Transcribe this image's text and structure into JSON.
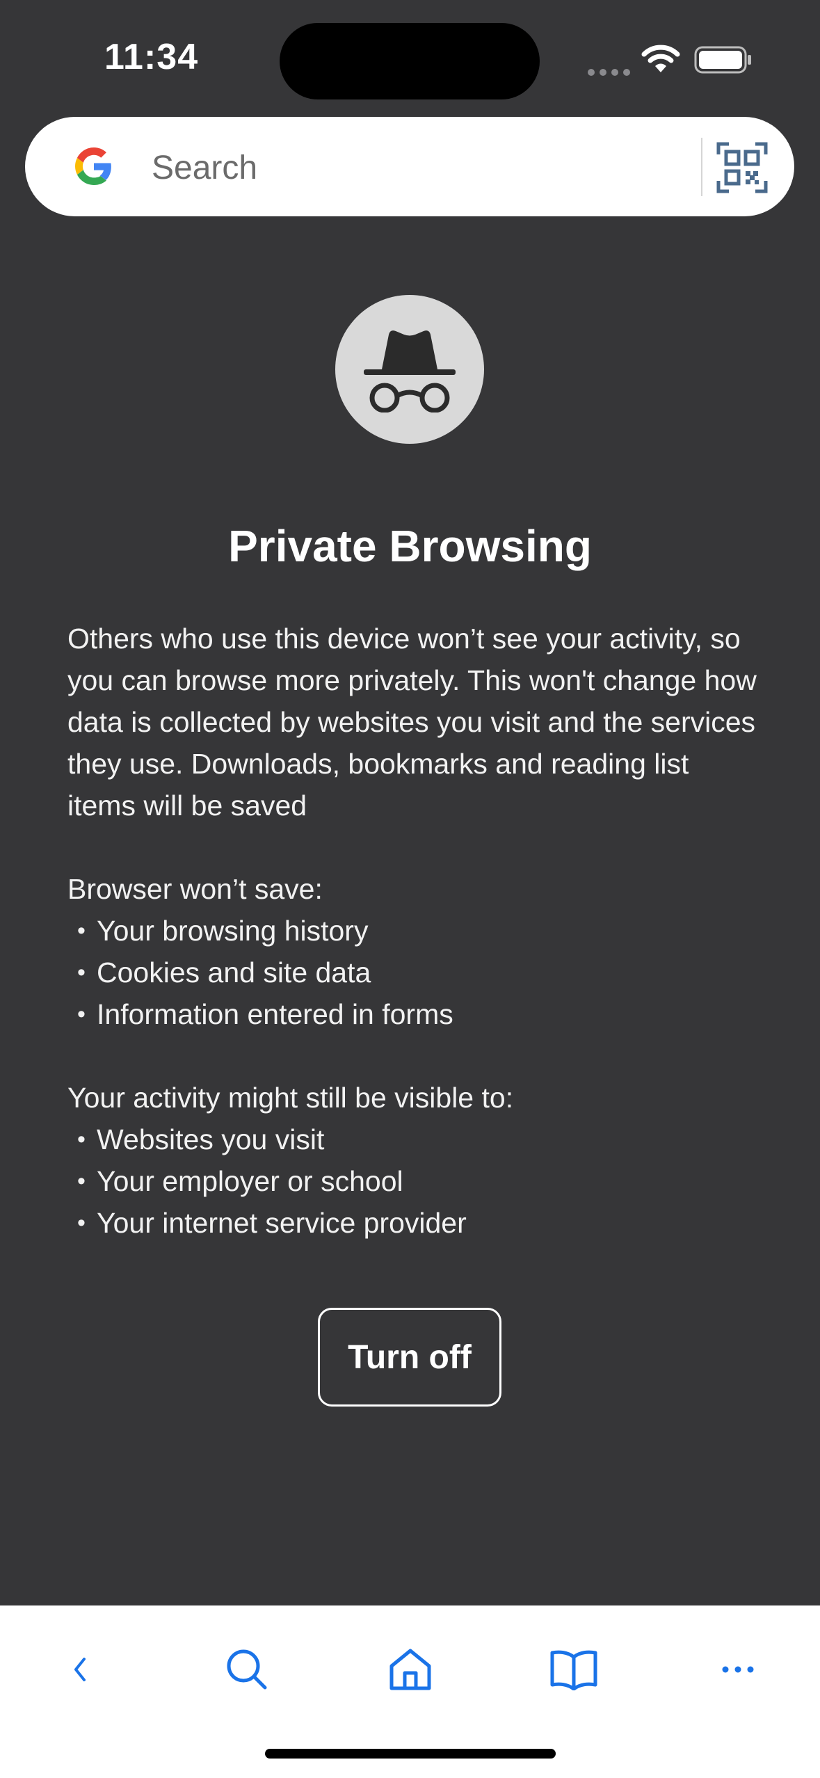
{
  "status_bar": {
    "time": "11:34",
    "icons": [
      "signal-dots-icon",
      "wifi-icon",
      "battery-icon"
    ]
  },
  "search": {
    "placeholder": "Search",
    "value": "",
    "left_icon": "google-logo",
    "right_icon": "qr-code-icon"
  },
  "private": {
    "icon": "incognito-icon",
    "title": "Private Browsing",
    "intro": "Others who use this device won’t see your activity, so you can browse more privately. This won't change how data is collected by websites you visit and the services they use. Downloads, bookmarks and reading list items will be saved",
    "not_saved_heading": "Browser won’t save:",
    "not_saved_items": [
      "Your browsing history",
      "Cookies and site data",
      "Information entered in forms"
    ],
    "visible_heading": "Your activity might still be visible to:",
    "visible_items": [
      "Websites you visit",
      "Your employer or school",
      "Your internet service provider"
    ],
    "turn_off_label": "Turn off"
  },
  "toolbar": {
    "items": [
      "back-icon",
      "search-icon",
      "home-icon",
      "reading-list-icon",
      "more-icon"
    ]
  },
  "colors": {
    "background": "#363638",
    "accent": "#1a73e8",
    "toolbar_bg": "#ffffff"
  }
}
